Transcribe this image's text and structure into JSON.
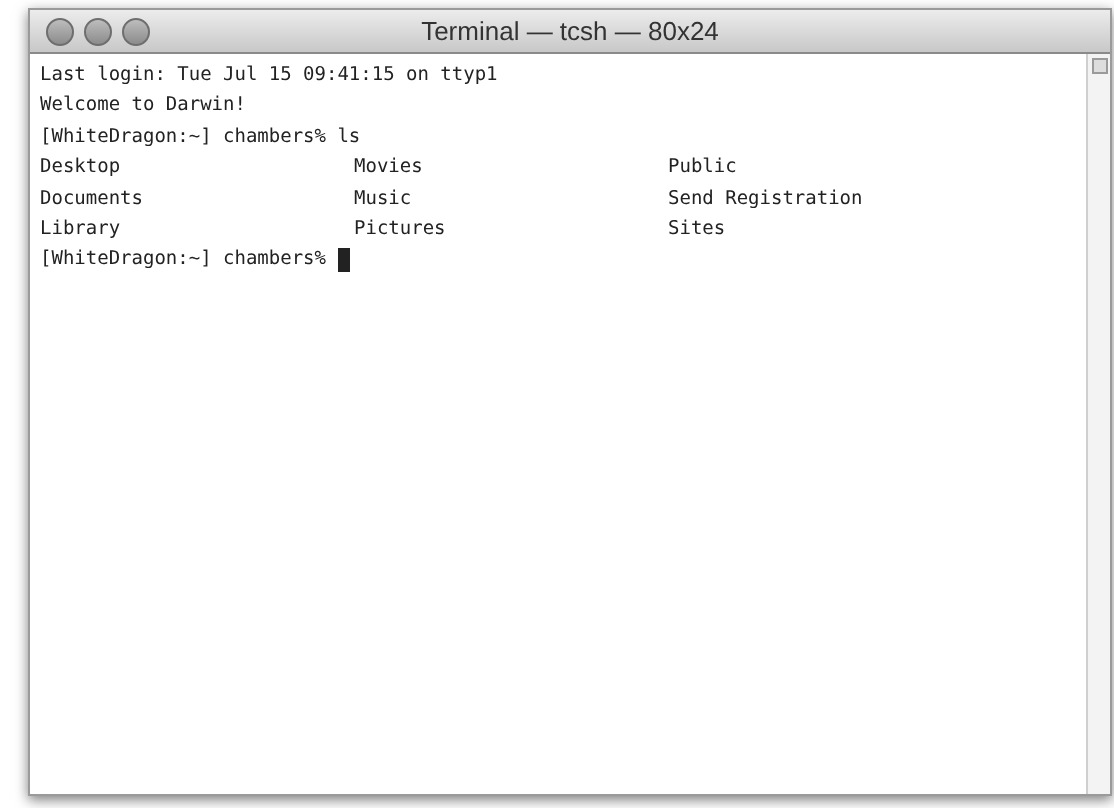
{
  "window": {
    "title": "Terminal — tcsh — 80x24"
  },
  "terminal": {
    "lines": [
      {
        "kind": "text",
        "text": "Last login: Tue Jul 15 09:41:15 on ttyp1"
      },
      {
        "kind": "text",
        "text": "Welcome to Darwin!"
      },
      {
        "kind": "text",
        "text": "[WhiteDragon:~] chambers% ls"
      },
      {
        "kind": "columns",
        "cells": [
          "Desktop",
          "Movies",
          "Public"
        ]
      },
      {
        "kind": "columns",
        "cells": [
          "Documents",
          "Music",
          "Send Registration"
        ]
      },
      {
        "kind": "columns",
        "cells": [
          "Library",
          "Pictures",
          "Sites"
        ]
      },
      {
        "kind": "prompt",
        "text": "[WhiteDragon:~] chambers%",
        "cursor": true
      }
    ]
  }
}
